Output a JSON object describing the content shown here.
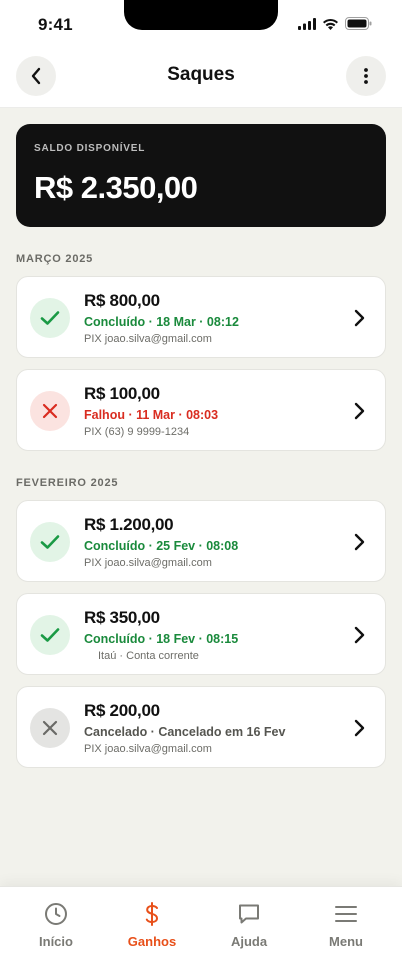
{
  "status_bar": {
    "time": "9:41"
  },
  "header": {
    "title": "Saques",
    "back_icon": "chevron-left-icon",
    "more_icon": "more-vertical-icon"
  },
  "balance": {
    "label": "SALDO DISPONÍVEL",
    "value": "R$ 2.350,00"
  },
  "sections": [
    {
      "label": "MARÇO 2025",
      "items": [
        {
          "amount": "R$ 800,00",
          "status": "Concluído · 18 Mar · 08:12",
          "destination": "PIX joao.silva@gmail.com",
          "state": "success",
          "icon": "check-icon"
        },
        {
          "amount": "R$ 100,00",
          "status": "Falhou · 11 Mar · 08:03",
          "destination": "PIX (63) 9 9999-1234",
          "state": "failed",
          "icon": "x-icon"
        }
      ]
    },
    {
      "label": "FEVEREIRO 2025",
      "items": [
        {
          "amount": "R$ 1.200,00",
          "status": "Concluído · 25 Fev · 08:08",
          "destination": "PIX joao.silva@gmail.com",
          "state": "success",
          "icon": "check-icon"
        },
        {
          "amount": "R$ 350,00",
          "status": "Concluído · 18 Fev · 08:15",
          "destination": "Itaú · Conta corrente",
          "state": "success",
          "icon": "check-icon"
        },
        {
          "amount": "R$ 200,00",
          "status": "Cancelado · Cancelado em 16 Fev",
          "destination": "PIX joao.silva@gmail.com",
          "state": "cancelled",
          "icon": "x-icon"
        }
      ]
    }
  ],
  "tabs": [
    {
      "label": "Início",
      "icon": "clock-icon",
      "active": false
    },
    {
      "label": "Ganhos",
      "icon": "dollar-icon",
      "active": true
    },
    {
      "label": "Ajuda",
      "icon": "chat-icon",
      "active": false
    },
    {
      "label": "Menu",
      "icon": "menu-icon",
      "active": false
    }
  ],
  "colors": {
    "accent": "#e8501a",
    "success": "#1a8a3c",
    "failed": "#d92c20",
    "cancelled": "#555550",
    "card_dark": "#111111"
  }
}
